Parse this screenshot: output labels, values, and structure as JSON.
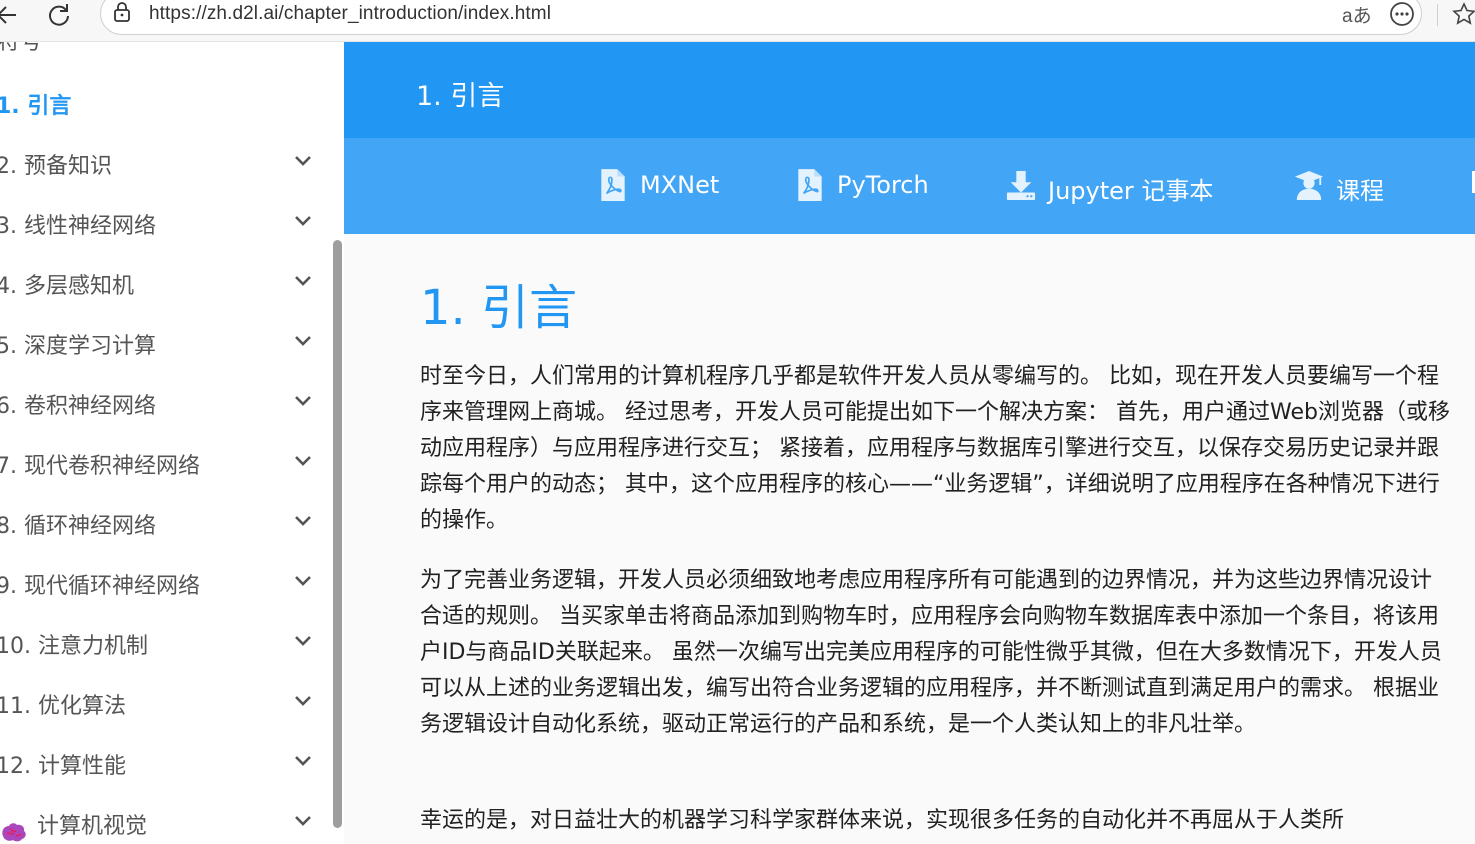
{
  "browser": {
    "url": "https://zh.d2l.ai/chapter_introduction/index.html",
    "reader_label": "aあ"
  },
  "sidebar": {
    "cut_label": "符号",
    "items": [
      {
        "label": "1. 引言",
        "active": true
      },
      {
        "label": "2. 预备知识"
      },
      {
        "label": "3. 线性神经网络"
      },
      {
        "label": "4. 多层感知机"
      },
      {
        "label": "5. 深度学习计算"
      },
      {
        "label": "6. 卷积神经网络"
      },
      {
        "label": "7. 现代卷积神经网络"
      },
      {
        "label": "8. 循环神经网络"
      },
      {
        "label": "9. 现代循环神经网络"
      },
      {
        "label": "10. 注意力机制"
      },
      {
        "label": "11. 优化算法"
      },
      {
        "label": "12. 计算性能"
      },
      {
        "label": "计算机视觉"
      }
    ]
  },
  "header": {
    "title": "1. 引言",
    "links": [
      {
        "label": "MXNet",
        "icon": "pdf-icon"
      },
      {
        "label": "PyTorch",
        "icon": "pdf-icon"
      },
      {
        "label": "Jupyter 记事本",
        "icon": "download-icon"
      },
      {
        "label": "课程",
        "icon": "graduation-cap-icon"
      }
    ]
  },
  "main": {
    "title": "1. 引言",
    "paragraphs": [
      "时至今日，人们常用的计算机程序几乎都是软件开发人员从零编写的。 比如，现在开发人员要编写一个程序来管理网上商城。 经过思考，开发人员可能提出如下一个解决方案： 首先，用户通过Web浏览器（或移动应用程序）与应用程序进行交互； 紧接着，应用程序与数据库引擎进行交互，以保存交易历史记录并跟踪每个用户的动态； 其中，这个应用程序的核心——“业务逻辑”，详细说明了应用程序在各种情况下进行的操作。",
      "为了完善业务逻辑，开发人员必须细致地考虑应用程序所有可能遇到的边界情况，并为这些边界情况设计合适的规则。 当买家单击将商品添加到购物车时，应用程序会向购物车数据库表中添加一个条目，将该用户ID与商品ID关联起来。 虽然一次编写出完美应用程序的可能性微乎其微，但在大多数情况下，开发人员可以从上述的业务逻辑出发，编写出符合业务逻辑的应用程序，并不断测试直到满足用户的需求。 根据业务逻辑设计自动化系统，驱动正常运行的产品和系统，是一个人类认知上的非凡壮举。",
      "幸运的是，对日益壮大的机器学习科学家群体来说，实现很多任务的自动化并不再屈从于人类所"
    ]
  },
  "colors": {
    "primary": "#2196f3",
    "primary_light": "#42a5f5",
    "content_bg": "#fafafa",
    "text": "#212121"
  }
}
